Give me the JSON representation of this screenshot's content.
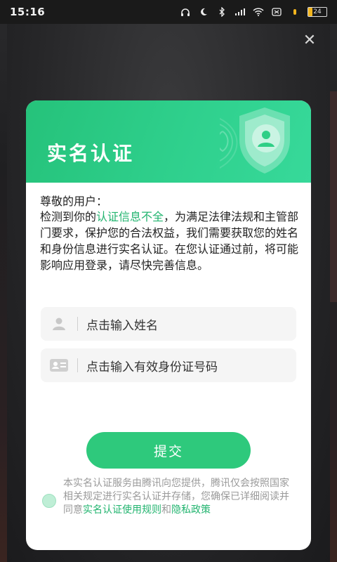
{
  "status_bar": {
    "time": "15:16",
    "battery_level": 0.24,
    "battery_text": "24"
  },
  "modal": {
    "title": "实名认证",
    "greeting": "尊敬的用户：",
    "message_pre": "检测到你的",
    "message_highlight": "认证信息不全",
    "message_post": "，为满足法律法规和主管部门要求，保护您的合法权益，我们需要获取您的姓名和身份信息进行实名认证。在您认证通过前，将可能影响应用登录，请尽快完善信息。",
    "name_input_placeholder": "点击输入姓名",
    "id_input_placeholder": "点击输入有效身份证号码",
    "submit_label": "提交",
    "agreement_pre": "本实名认证服务由腾讯向您提供，腾讯仅会按照国家相关规定进行实名认证并存储，您确保已详细阅读并同意",
    "agreement_link1": "实名认证使用规则",
    "agreement_and": "和",
    "agreement_link2": "隐私政策"
  },
  "colors": {
    "accent": "#2ec97c",
    "highlight_text": "#22b46f"
  }
}
